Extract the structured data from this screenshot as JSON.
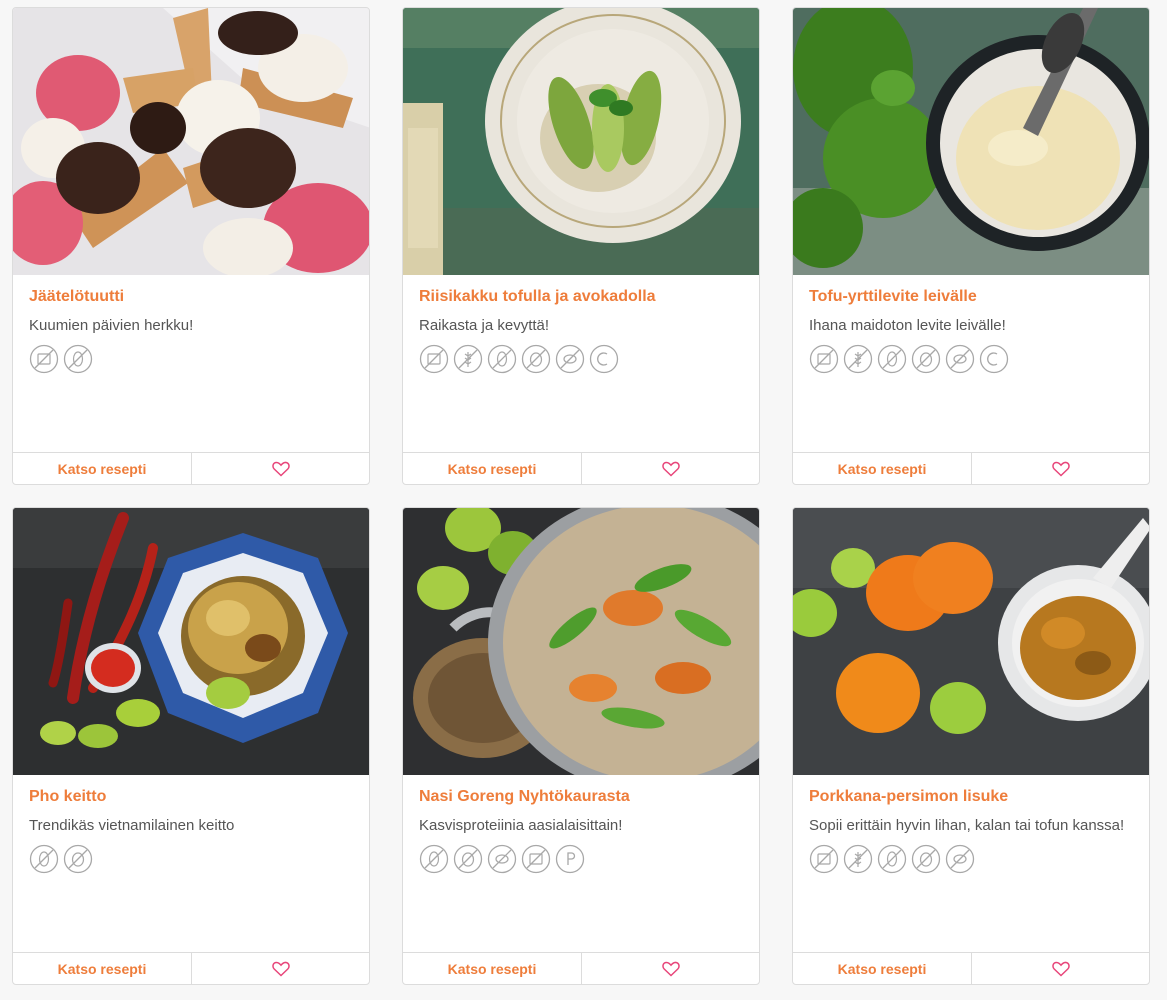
{
  "recipes": [
    {
      "title": "Jäätelötuutti",
      "subtitle": "Kuumien päivien herkku!",
      "diets": [
        "lactose-free-icon",
        "nut-free-icon"
      ],
      "view_label": "Katso resepti"
    },
    {
      "title": "Riisikakku tofulla ja avokadolla",
      "subtitle": "Raikasta ja kevyttä!",
      "diets": [
        "lactose-free-icon",
        "gluten-free-icon",
        "nut-free-icon",
        "egg-free-icon",
        "soy-free-icon",
        "vegan-icon"
      ],
      "view_label": "Katso resepti"
    },
    {
      "title": "Tofu-yrttilevite leivälle",
      "subtitle": "Ihana maidoton levite leivälle!",
      "diets": [
        "lactose-free-icon",
        "gluten-free-icon",
        "nut-free-icon",
        "egg-free-icon",
        "soy-free-icon",
        "vegan-icon"
      ],
      "view_label": "Katso resepti"
    },
    {
      "title": "Pho keitto",
      "subtitle": "Trendikäs vietnamilainen keitto",
      "diets": [
        "nut-free-icon",
        "egg-free-icon"
      ],
      "view_label": "Katso resepti"
    },
    {
      "title": "Nasi Goreng Nyhtökaurasta",
      "subtitle": "Kasvisproteiinia aasialaisittain!",
      "diets": [
        "nut-free-icon",
        "egg-free-icon",
        "soy-free-icon",
        "lactose-free-icon",
        "protein-icon"
      ],
      "view_label": "Katso resepti"
    },
    {
      "title": "Porkkana-persimon lisuke",
      "subtitle": "Sopii erittäin hyvin lihan, kalan tai tofun kanssa!",
      "diets": [
        "lactose-free-icon",
        "gluten-free-icon",
        "nut-free-icon",
        "egg-free-icon",
        "soy-free-icon"
      ],
      "view_label": "Katso resepti"
    }
  ],
  "colors": {
    "accent": "#ee7d3b",
    "heart": "#e8457a",
    "icon": "#a8a8a8"
  }
}
